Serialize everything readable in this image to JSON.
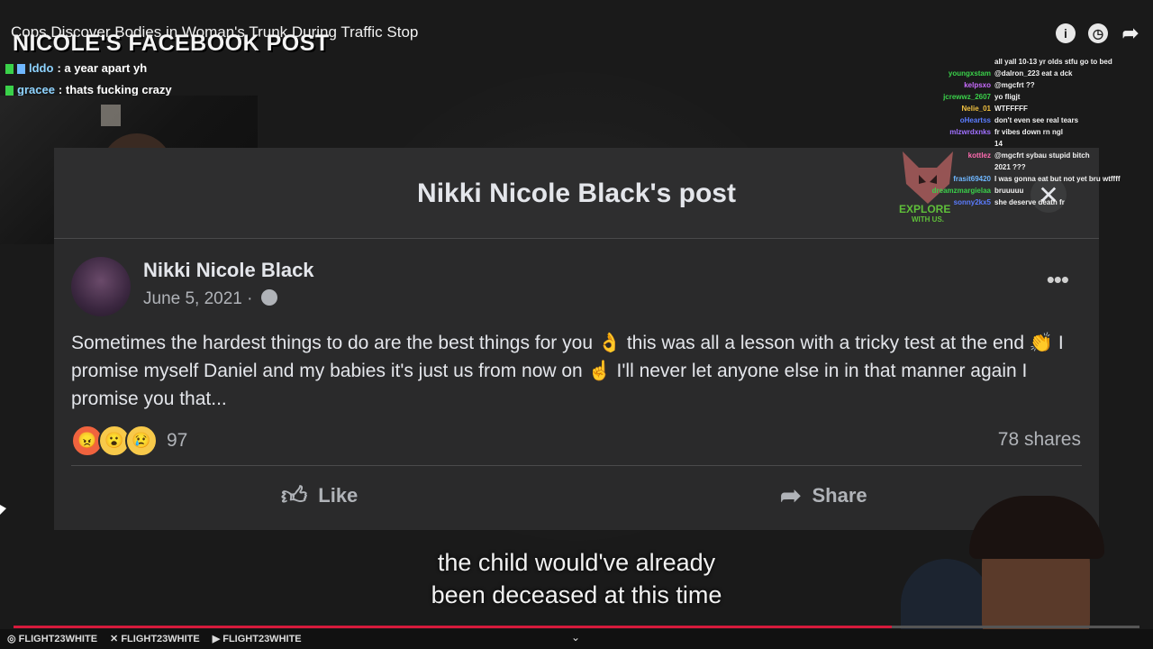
{
  "video": {
    "title": "Cops Discover Bodies in Woman's Trunk During Traffic Stop",
    "overlay_title": "NICOLE'S FACEBOOK POST",
    "progress": 0.78
  },
  "top_icons": [
    "info-icon",
    "clock-icon",
    "share-arrow-icon"
  ],
  "chat_left": [
    {
      "user": "lddo",
      "message": ": a year apart yh"
    },
    {
      "user": "gracee",
      "message": ": thats fucking crazy"
    }
  ],
  "fb_post": {
    "header_title": "Nikki Nicole Black's post",
    "author": "Nikki Nicole Black",
    "date": "June 5, 2021 ·",
    "text": "Sometimes the hardest things to do are the best things for you 👌 this was all a lesson with a tricky test at the end 👏 I promise myself Daniel and my babies it's just us from now on ☝ I'll never let anyone else in in that manner again I promise you that...",
    "reaction_count": "97",
    "shares": "78 shares",
    "like_label": "Like",
    "share_label": "Share",
    "more_label": "•••",
    "close_label": "✕"
  },
  "caption": {
    "line1": "the child would've already",
    "line2": "been deceased at this time"
  },
  "chat_right": [
    {
      "user": "",
      "message": "all yall 10-13 yr olds stfu go to bed",
      "color": "#5b7cff"
    },
    {
      "user": "youngxstam",
      "message": "@dalron_223 eat a dck",
      "color": "#3ad14a"
    },
    {
      "user": "kelpsxo",
      "message": "@mgcfrt ??",
      "color": "#c96cff"
    },
    {
      "user": "jcrewwz_2607",
      "message": "yo fligjt",
      "color": "#3ad14a"
    },
    {
      "user": "Nelie_01",
      "message": "WTFFFFF",
      "color": "#f0c040"
    },
    {
      "user": "oHeartss",
      "message": "don't even see real tears",
      "color": "#5b7cff"
    },
    {
      "user": "mlzwrdxnks",
      "message": "fr vibes down rn ngl",
      "color": "#a070ff"
    },
    {
      "user": "",
      "message": "14",
      "color": "#ffffff"
    },
    {
      "user": "kottlez",
      "message": "@mgcfrt sybau stupid bitch",
      "color": "#ff6bb0"
    },
    {
      "user": "",
      "message": "2021 ???",
      "color": "#ff4040"
    },
    {
      "user": "frasit69420",
      "message": "I was gonna eat but not yet bru wtffff",
      "color": "#6fb7ff"
    },
    {
      "user": "dreamzmargielaa",
      "message": "bruuuuu",
      "color": "#3ad14a"
    },
    {
      "user": "sonny2kx5",
      "message": "she deserve death fr",
      "color": "#5b7cff"
    }
  ],
  "wolf_logo": {
    "line1": "EXPLORE",
    "line2": "WITH US."
  },
  "bottom_bar": {
    "socials": [
      "FLIGHT23WHITE",
      "FLIGHT23WHITE",
      "FLIGHT23WHITE"
    ],
    "chevron": "⌄"
  }
}
